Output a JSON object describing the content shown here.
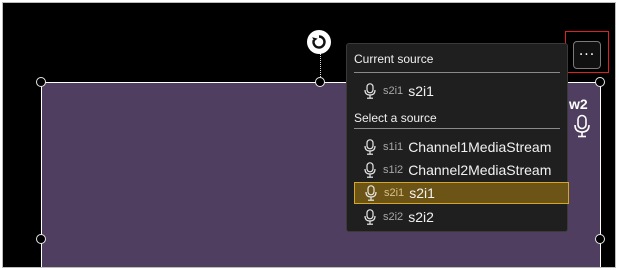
{
  "current_source": {
    "header": "Current source",
    "item": {
      "id": "s2i1",
      "name": "s2i1",
      "icon": "microphone-icon"
    }
  },
  "select_source": {
    "header": "Select a source",
    "items": [
      {
        "id": "s1i1",
        "name": "Channel1MediaStream",
        "icon": "microphone-icon",
        "selected": false
      },
      {
        "id": "s1i2",
        "name": "Channel2MediaStream",
        "icon": "microphone-icon",
        "selected": false
      },
      {
        "id": "s2i1",
        "name": "s2i1",
        "icon": "microphone-icon",
        "selected": true
      },
      {
        "id": "s2i2",
        "name": "s2i2",
        "icon": "microphone-icon",
        "selected": false
      }
    ]
  },
  "more_button": {
    "label": "···",
    "icon": "more-icon"
  },
  "tile": {
    "label_fragment": "w2",
    "icon": "microphone-icon"
  },
  "colors": {
    "canvas": "#4f3e5f",
    "popup_bg": "#1f1f1f",
    "selected_bg": "#6b5416",
    "selected_border": "#d4a62a",
    "highlight_box": "#e02020"
  }
}
